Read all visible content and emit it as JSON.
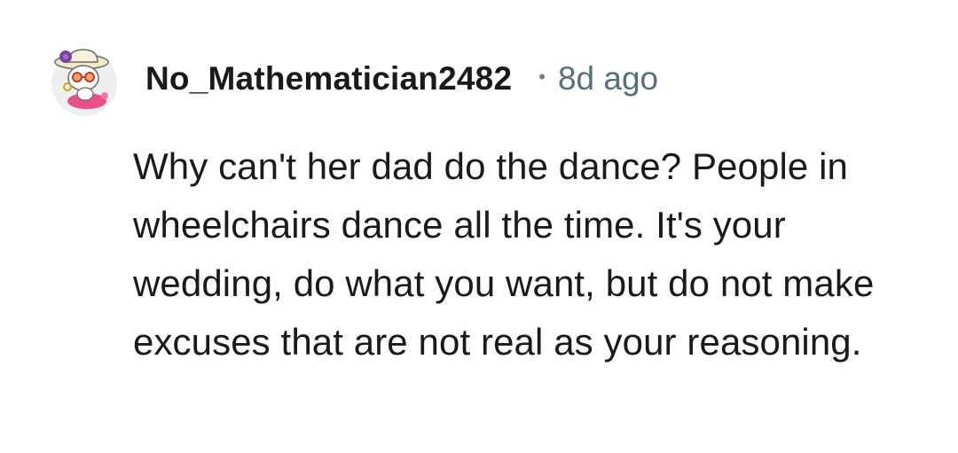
{
  "comment": {
    "author": "No_Mathematician2482",
    "separator": "•",
    "timestamp": "8d ago",
    "text": "Why can't her dad do the dance? People in wheelchairs dance all the time. It's your wedding, do what you want, but do not make excuses that are not real as your reasoning."
  },
  "avatar": {
    "icon": "snoo-avatar-icon",
    "background": "#edeff1",
    "hat_color": "#f3e9c8",
    "flower_color": "#7b3fa0",
    "accent_color": "#e8508a"
  }
}
